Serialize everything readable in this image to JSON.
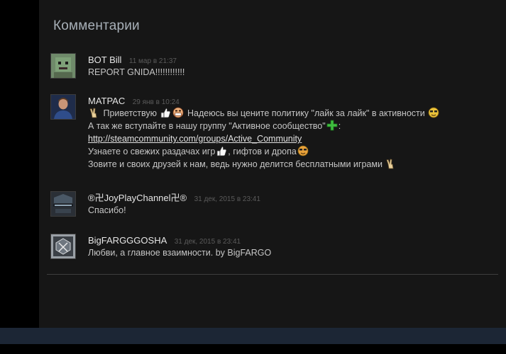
{
  "section": {
    "title": "Комментарии"
  },
  "comments": [
    {
      "author": "BOT Bill",
      "timestamp": "11 мар в 21:37",
      "lines": [
        "REPORT GNIDA!!!!!!!!!!!!"
      ]
    },
    {
      "author": "MATPAC",
      "timestamp": "29 янв в 10:24",
      "line1_a": "Приветствую",
      "line1_b": "Надеюсь вы цените политику \"лайк за лайк\" в активности",
      "line2": "А так же вступайте в нашу группу \"Активное сообщество\"",
      "line2_end": ":",
      "link": "http://steamcommunity.com/groups/Active_Community",
      "line4_a": "Узнаете о свежих раздачах игр",
      "line4_b": ", гифтов и дропа",
      "line5": "Зовите и своих друзей к нам, ведь нужно делится бесплатными играми"
    },
    {
      "author": "®卍JoyPlayChannel卍®",
      "timestamp": "31 дек, 2015 в 23:41",
      "lines": [
        "Спасибо!"
      ]
    },
    {
      "author": "BigFARGGGOSHA",
      "timestamp": "31 дек, 2015 в 23:41",
      "lines": [
        "Любви, а главное взаимности. by BigFARGO"
      ]
    }
  ],
  "emoticons": [
    "peace-sign-icon",
    "thumbs-up-icon",
    "grinning-face-icon",
    "sunglasses-face-icon",
    "green-plus-icon"
  ],
  "colors": {
    "page_bg": "#000000",
    "panel_bg": "#161616",
    "title": "#a8b0b8",
    "author": "#e6e6e6",
    "timestamp": "#5b5b5b",
    "text": "#c6c6c6",
    "footer_bar": "#1c2635"
  }
}
